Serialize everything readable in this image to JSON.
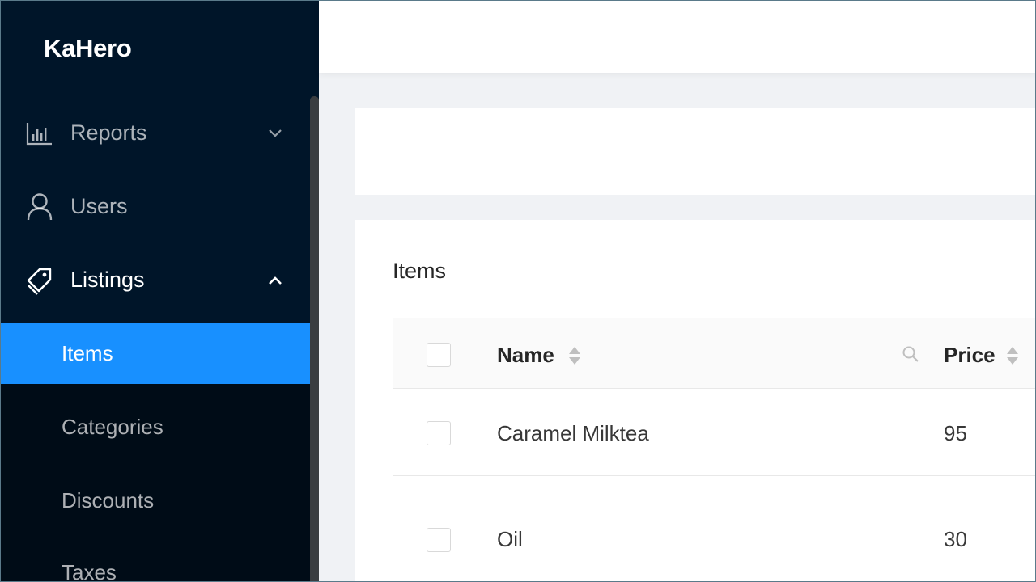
{
  "app": {
    "title": "KaHero"
  },
  "sidebar": {
    "menu": [
      {
        "label": "Reports",
        "icon": "bar-chart-icon",
        "expanded": false
      },
      {
        "label": "Users",
        "icon": "user-icon",
        "expanded": false
      },
      {
        "label": "Listings",
        "icon": "tags-icon",
        "expanded": true
      }
    ],
    "submenu": [
      {
        "label": "Items",
        "selected": true
      },
      {
        "label": "Categories",
        "selected": false
      },
      {
        "label": "Discounts",
        "selected": false
      },
      {
        "label": "Taxes",
        "selected": false
      }
    ]
  },
  "main": {
    "card_title": "Items",
    "table": {
      "columns": [
        "Name",
        "Price"
      ],
      "rows": [
        {
          "name": "Caramel Milktea",
          "price": "95"
        },
        {
          "name": "Oil",
          "price": "30"
        }
      ]
    }
  },
  "colors": {
    "sidebar_bg": "#001529",
    "submenu_bg": "#000c17",
    "accent": "#1890ff"
  }
}
